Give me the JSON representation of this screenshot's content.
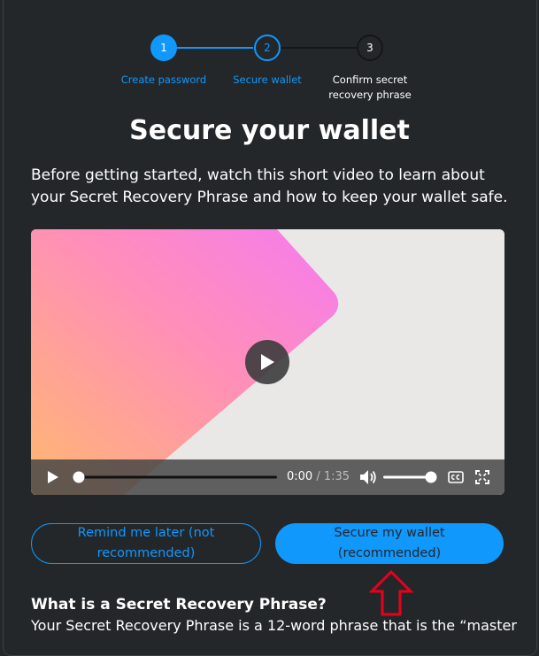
{
  "stepper": {
    "steps": [
      {
        "number": "1",
        "label": "Create password"
      },
      {
        "number": "2",
        "label": "Secure wallet"
      },
      {
        "number": "3",
        "label_line1": "Confirm secret",
        "label_line2": "recovery phrase"
      }
    ]
  },
  "title": "Secure your wallet",
  "intro": "Before getting started, watch this short video to learn about your Secret Recovery Phrase and how to keep your wallet safe.",
  "video": {
    "current_time": "0:00",
    "separator": " / ",
    "duration": "1:35",
    "progress": 0,
    "volume": 1
  },
  "buttons": {
    "remind_later": "Remind me later (not recommended)",
    "secure_wallet": "Secure my wallet (recommended)"
  },
  "section": {
    "heading": "What is a Secret Recovery Phrase?",
    "text": "Your Secret Recovery Phrase is a 12-word phrase that is the “master"
  },
  "colors": {
    "accent": "#1098fc",
    "background": "#24272a",
    "annotation_arrow": "#e8001c"
  }
}
